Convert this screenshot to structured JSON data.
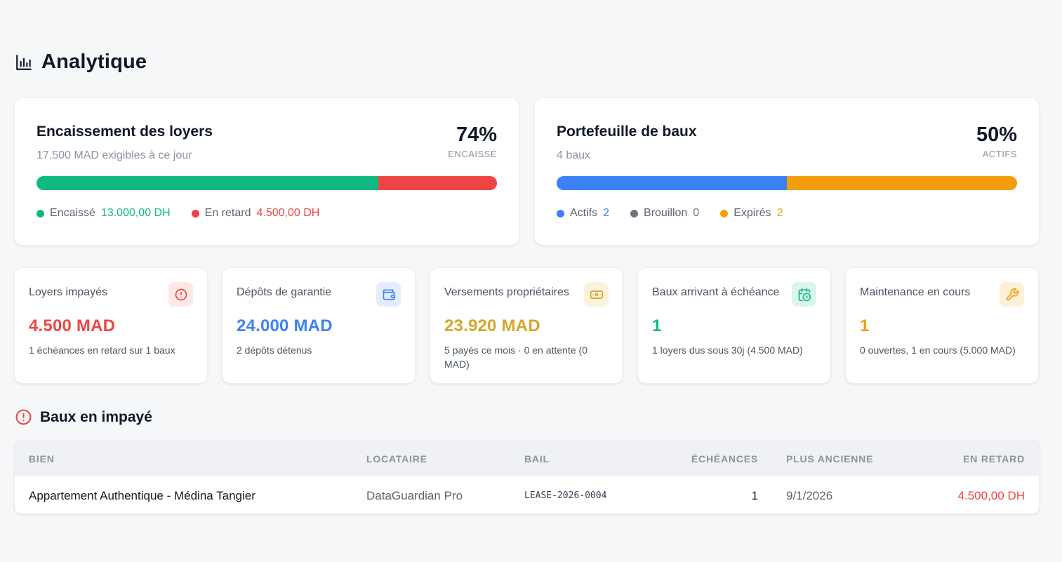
{
  "page": {
    "title": "Analytique"
  },
  "colors": {
    "green": "#10b981",
    "red": "#ef4444",
    "blue": "#3b82f6",
    "gray": "#6b7280",
    "orange": "#f59e0b",
    "gold": "#d4a72c"
  },
  "collection": {
    "title": "Encaissement des loyers",
    "subtitle": "17.500 MAD exigibles à ce jour",
    "percent": "74%",
    "percent_label": "ENCAISSÉ",
    "segments": [
      {
        "label": "Encaissé",
        "value": "13.000,00 DH",
        "fraction": 0.743,
        "color": "#10b981"
      },
      {
        "label": "En retard",
        "value": "4.500,00 DH",
        "fraction": 0.257,
        "color": "#ef4444"
      }
    ]
  },
  "portfolio": {
    "title": "Portefeuille de baux",
    "subtitle": "4 baux",
    "percent": "50%",
    "percent_label": "ACTIFS",
    "segments": [
      {
        "label": "Actifs",
        "value": "2",
        "fraction": 0.5,
        "color": "#3b82f6"
      },
      {
        "label": "Brouillon",
        "value": "0",
        "fraction": 0,
        "color": "#6b7280"
      },
      {
        "label": "Expirés",
        "value": "2",
        "fraction": 0.5,
        "color": "#f59e0b"
      }
    ]
  },
  "stats": [
    {
      "title": "Loyers impayés",
      "value": "4.500 MAD",
      "desc": "1 échéances en retard sur 1 baux",
      "icon": "alert-circle-icon",
      "color": "#ef4444",
      "bg": "#fde8e8"
    },
    {
      "title": "Dépôts de garantie",
      "value": "24.000 MAD",
      "desc": "2 dépôts détenus",
      "icon": "wallet-icon",
      "color": "#3b82f6",
      "bg": "#e3edfd"
    },
    {
      "title": "Versements propriétaires",
      "value": "23.920 MAD",
      "desc": "5 payés ce mois · 0 en attente (0 MAD)",
      "icon": "banknote-icon",
      "color": "#d4a72c",
      "bg": "#fbf3dc"
    },
    {
      "title": "Baux arrivant à échéance",
      "value": "1",
      "desc": "1 loyers dus sous 30j (4.500 MAD)",
      "icon": "calendar-clock-icon",
      "color": "#10b981",
      "bg": "#dcf5ea"
    },
    {
      "title": "Maintenance en cours",
      "value": "1",
      "desc": "0 ouvertes, 1 en cours (5.000 MAD)",
      "icon": "wrench-icon",
      "color": "#f59e0b",
      "bg": "#fdf0d9"
    }
  ],
  "overdue": {
    "title": "Baux en impayé",
    "columns": [
      "BIEN",
      "LOCATAIRE",
      "BAIL",
      "ÉCHÉANCES",
      "PLUS ANCIENNE",
      "EN RETARD"
    ],
    "rows": [
      {
        "property": "Appartement Authentique - Médina Tangier",
        "tenant": "DataGuardian Pro",
        "lease": "LEASE-2026-0004",
        "installments": "1",
        "oldest": "9/1/2026",
        "overdue": "4.500,00 DH"
      }
    ]
  }
}
